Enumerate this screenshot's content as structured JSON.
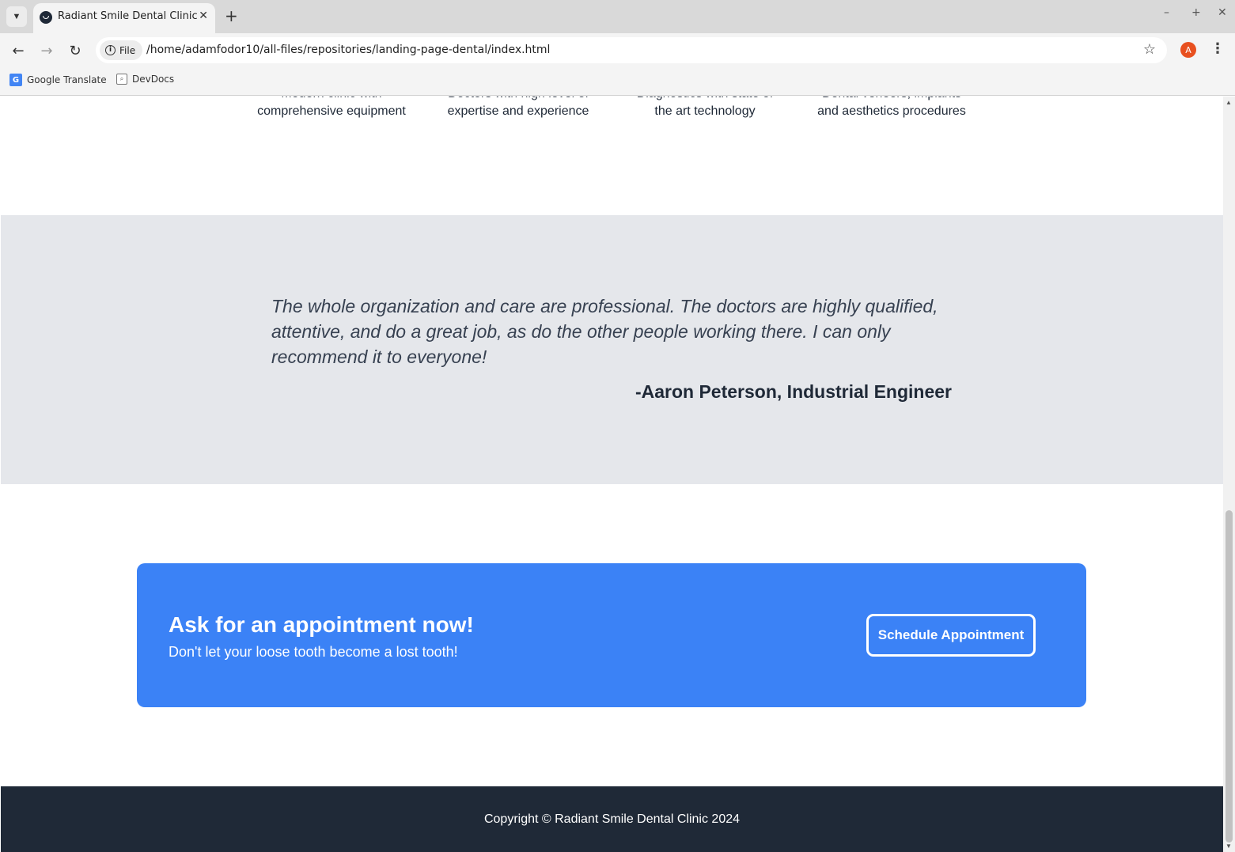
{
  "browser": {
    "tab_title": "Radiant Smile Dental Clinic",
    "tab_close": "✕",
    "new_tab": "+",
    "window_controls": {
      "minimize": "–",
      "maximize": "+",
      "close": "✕"
    },
    "file_label": "File",
    "url": "/home/adamfodor10/all-files/repositories/landing-page-dental/index.html",
    "profile_initial": "A",
    "bookmarks": [
      {
        "label": "Google Translate"
      },
      {
        "label": "DevDocs"
      }
    ]
  },
  "features": [
    {
      "line1": "Modern clinic with",
      "line2": "comprehensive equipment"
    },
    {
      "line1": "Doctors with high level of",
      "line2": "expertise and experience"
    },
    {
      "line1": "Diagnostics with state of",
      "line2": "the art technology"
    },
    {
      "line1": "Dental veneers, implants",
      "line2": "and aesthetics procedures"
    }
  ],
  "testimonial": {
    "quote": "The whole organization and care are professional. The doctors are highly qualified, attentive, and do a great job, as do the other people working there. I can only recommend it to everyone!",
    "author": "-Aaron Peterson, Industrial Engineer"
  },
  "cta": {
    "title": "Ask for an appointment now!",
    "subtitle": "Don't let your loose tooth become a lost tooth!",
    "button_label": "Schedule Appointment"
  },
  "footer": {
    "copyright": "Copyright  ©  Radiant Smile Dental Clinic 2024"
  },
  "colors": {
    "accent": "#3b82f6",
    "dark": "#1f2937",
    "testimonial_bg": "#e5e7eb"
  }
}
